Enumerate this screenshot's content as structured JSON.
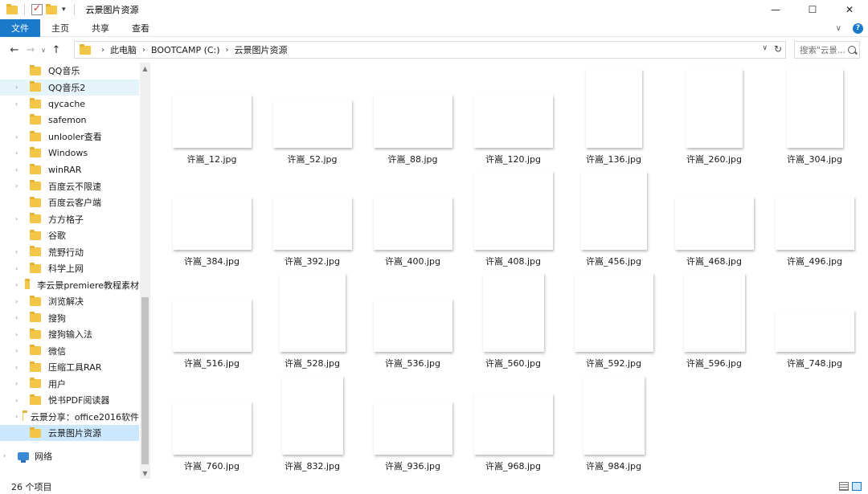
{
  "window": {
    "title": "云景图片资源",
    "controls": [
      "—",
      "☐",
      "✕"
    ]
  },
  "ribbon": {
    "tabs": [
      "文件",
      "主页",
      "共享",
      "查看"
    ]
  },
  "address": {
    "crumbs": [
      "此电脑",
      "BOOTCAMP (C:)",
      "云景图片资源"
    ],
    "search_placeholder": "搜索\"云景..."
  },
  "nav": {
    "items": [
      {
        "label": "QQ音乐",
        "state": "normal",
        "expandable": false
      },
      {
        "label": "QQ音乐2",
        "state": "hover",
        "expandable": true
      },
      {
        "label": "qycache",
        "state": "normal",
        "expandable": true
      },
      {
        "label": "safemon",
        "state": "normal",
        "expandable": false
      },
      {
        "label": "unlooler查看",
        "state": "normal",
        "expandable": true
      },
      {
        "label": "Windows",
        "state": "normal",
        "expandable": true
      },
      {
        "label": "winRAR",
        "state": "normal",
        "expandable": true
      },
      {
        "label": "百度云不限速",
        "state": "normal",
        "expandable": true
      },
      {
        "label": "百度云客户端",
        "state": "normal",
        "expandable": false
      },
      {
        "label": "方方格子",
        "state": "normal",
        "expandable": true
      },
      {
        "label": "谷歌",
        "state": "normal",
        "expandable": false
      },
      {
        "label": "荒野行动",
        "state": "normal",
        "expandable": true
      },
      {
        "label": "科学上网",
        "state": "normal",
        "expandable": true
      },
      {
        "label": "李云景premiere教程素材",
        "state": "normal",
        "expandable": true
      },
      {
        "label": "浏览解决",
        "state": "normal",
        "expandable": true
      },
      {
        "label": "搜狗",
        "state": "normal",
        "expandable": true
      },
      {
        "label": "搜狗输入法",
        "state": "normal",
        "expandable": true
      },
      {
        "label": "微信",
        "state": "normal",
        "expandable": true
      },
      {
        "label": "压缩工具RAR",
        "state": "normal",
        "expandable": true
      },
      {
        "label": "用户",
        "state": "normal",
        "expandable": true
      },
      {
        "label": "悦书PDF阅读器",
        "state": "normal",
        "expandable": true
      },
      {
        "label": "云景分享：office2016软件",
        "state": "normal",
        "expandable": true
      },
      {
        "label": "云景图片资源",
        "state": "selected",
        "expandable": false
      }
    ],
    "network": "网络"
  },
  "files": [
    {
      "name": "许嵩_12.jpg",
      "orient": "land",
      "colors": [
        "#6b6a63",
        "#a89e86",
        "#2b2a28"
      ]
    },
    {
      "name": "许嵩_52.jpg",
      "orient": "wide",
      "colors": [
        "#1c3f6e",
        "#c9b49a",
        "#101622"
      ]
    },
    {
      "name": "许嵩_88.jpg",
      "orient": "land",
      "colors": [
        "#3e5a6e",
        "#1d2833",
        "#8aa3b3"
      ]
    },
    {
      "name": "许嵩_120.jpg",
      "orient": "land",
      "colors": [
        "#2f7fc4",
        "#b82a3c",
        "#0e2b4a"
      ]
    },
    {
      "name": "许嵩_136.jpg",
      "orient": "port",
      "colors": [
        "#1f6fc7",
        "#0a2a58",
        "#c6353b"
      ]
    },
    {
      "name": "许嵩_260.jpg",
      "orient": "port",
      "colors": [
        "#3d2c5e",
        "#a99cc3",
        "#dcd6e6"
      ]
    },
    {
      "name": "许嵩_304.jpg",
      "orient": "port",
      "colors": [
        "#c9c3b6",
        "#1b1b1b",
        "#8e887b"
      ]
    },
    {
      "name": "许嵩_384.jpg",
      "orient": "land",
      "colors": [
        "#8fb7d6",
        "#5b5249",
        "#2a2622"
      ]
    },
    {
      "name": "许嵩_392.jpg",
      "orient": "land",
      "colors": [
        "#7a7a7a",
        "#d5d5d5",
        "#151515"
      ]
    },
    {
      "name": "许嵩_400.jpg",
      "orient": "land",
      "colors": [
        "#0d1d6b",
        "#2b59d1",
        "#0a0a26"
      ]
    },
    {
      "name": "许嵩_408.jpg",
      "orient": "sq",
      "colors": [
        "#e8e8e8",
        "#ffffff",
        "#2a2a2a"
      ]
    },
    {
      "name": "许嵩_456.jpg",
      "orient": "port2",
      "colors": [
        "#1f4fb6",
        "#5a86de",
        "#0b1d4d"
      ]
    },
    {
      "name": "许嵩_468.jpg",
      "orient": "land",
      "colors": [
        "#d2c7b6",
        "#5b4a36",
        "#1f1a14"
      ]
    },
    {
      "name": "许嵩_496.jpg",
      "orient": "land",
      "colors": [
        "#2a2a2a",
        "#9a9a9a",
        "#e2e2e2"
      ]
    },
    {
      "name": "许嵩_516.jpg",
      "orient": "land",
      "colors": [
        "#a9c8e3",
        "#c9c2b0",
        "#1c1c1c"
      ]
    },
    {
      "name": "许嵩_528.jpg",
      "orient": "port2",
      "colors": [
        "#d9d3c8",
        "#1b1b1b",
        "#f1ece3"
      ]
    },
    {
      "name": "许嵩_536.jpg",
      "orient": "land",
      "colors": [
        "#e0622d",
        "#8b2f1d",
        "#1a1418"
      ]
    },
    {
      "name": "许嵩_560.jpg",
      "orient": "port3",
      "colors": [
        "#4a4a4a",
        "#d8d8d8",
        "#0f0f0f"
      ]
    },
    {
      "name": "许嵩_592.jpg",
      "orient": "sq2",
      "colors": [
        "#f4f4f4",
        "#111111",
        "#bdbdbd"
      ]
    },
    {
      "name": "许嵩_596.jpg",
      "orient": "port3",
      "colors": [
        "#c19a63",
        "#5e4a33",
        "#1d1712"
      ]
    },
    {
      "name": "许嵩_748.jpg",
      "orient": "land2",
      "colors": [
        "#f1c232",
        "#ffffff",
        "#d4a017"
      ]
    },
    {
      "name": "许嵩_760.jpg",
      "orient": "land",
      "colors": [
        "#6a6a6a",
        "#e6e6e6",
        "#222222"
      ]
    },
    {
      "name": "许嵩_832.jpg",
      "orient": "port3",
      "colors": [
        "#6b4f35",
        "#efe6d6",
        "#1f150d"
      ]
    },
    {
      "name": "许嵩_936.jpg",
      "orient": "land",
      "colors": [
        "#e7e7e7",
        "#8c8c8c",
        "#1e1e1e"
      ]
    },
    {
      "name": "许嵩_968.jpg",
      "orient": "land3",
      "colors": [
        "#4d87cf",
        "#d6e6f6",
        "#b02a2e"
      ]
    },
    {
      "name": "许嵩_984.jpg",
      "orient": "port3",
      "colors": [
        "#dcdcdc",
        "#777777",
        "#1a1a1a"
      ]
    }
  ],
  "status": {
    "count_text": "26 个项目"
  }
}
